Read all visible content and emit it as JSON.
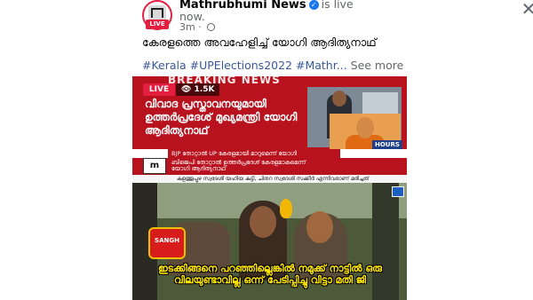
{
  "post": {
    "page_name": "Mathrubhumi News",
    "status": "is live",
    "status_cont": "now.",
    "time": "3m",
    "avatar_live": "LIVE",
    "caption": "കേരളത്തെ അവഹേളിച്ച് യോഗി ആദിത്യനാഥ്",
    "hashtags": "#Kerala #UPElections2022 #Mathr...",
    "see_more": "See more",
    "close_glyph": "✕",
    "verified_glyph": "✓"
  },
  "video": {
    "breaking": "BREAKING NEWS",
    "live": "LIVE",
    "viewers": "👁 1.5K",
    "headline": "വിവാദ പ്രസ്താവനയുമായി ഉത്തർപ്രദേശ് മുഖ്യമന്ത്രി യോഗി ആദിത്യനാഥ്",
    "ticker1": "BJP തോറ്റാൽ UP കേരളമായി മാറുമെന്ന് യോഗി",
    "ticker2": "ബിജെപി തോറ്റാൽ ഉത്തർപ്രദേശ് കേരളമാകുമെന്ന് യോഗി ആദിത്യനാഥ്",
    "ticker3": "കുളത്തൂപ്പുഴ സ്വദേശി യഹിയ കുട്ടി, ചിതറ സ്വദേശി സക്കീർ എന്നിവരാണ് മരിച്ചത്",
    "logo": "m",
    "brand": "HOURS",
    "sangh_label": "SANGH",
    "dialogue": "ഇടക്കിങ്ങനെ പറഞ്ഞില്ലെങ്കിൽ നമുക്ക് നാട്ടിൽ ഒരു വിലയുണ്ടാവില്ല ഒന്ന് പേടിപ്പിച്ചു വിട്ടാ മതി ജി"
  },
  "colors": {
    "accent_red": "#e41e3f",
    "link": "#385898",
    "news_red": "#b8121f",
    "dialogue_yellow": "#ffe600"
  }
}
